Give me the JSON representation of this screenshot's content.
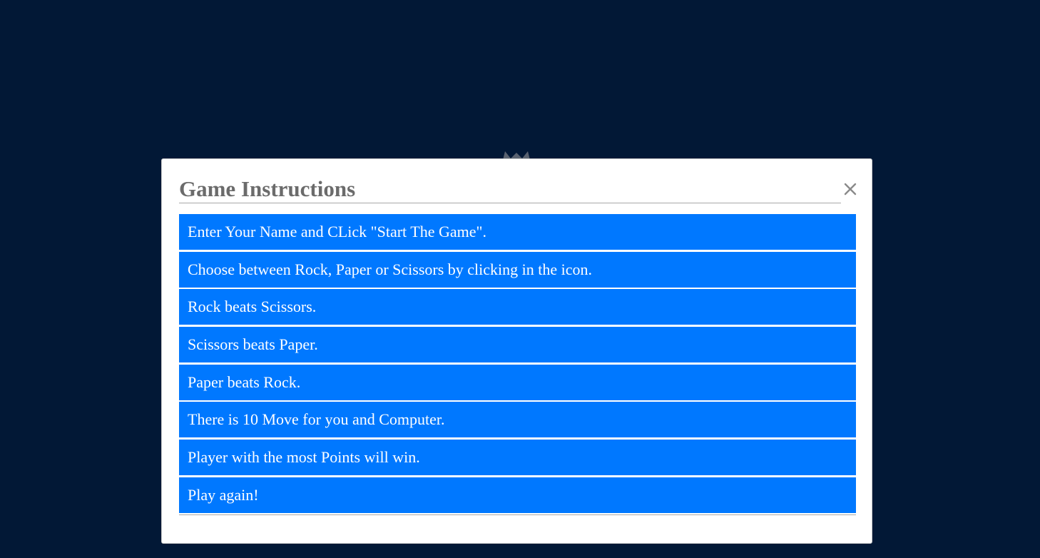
{
  "modal": {
    "title": "Game Instructions",
    "close_icon": "close-icon",
    "instructions": [
      "Enter Your Name and CLick \"Start The Game\".",
      "Choose between Rock, Paper or Scissors by clicking in the icon.",
      "Rock beats Scissors.",
      "Scissors beats Paper.",
      "Paper beats Rock.",
      "There is 10 Move for you and Computer.",
      "Player with the most Points will win.",
      "Play again!"
    ]
  },
  "colors": {
    "background": "#021836",
    "item_background": "#0078ff",
    "item_text": "#ffffff",
    "title_text": "#6b6b6b"
  }
}
